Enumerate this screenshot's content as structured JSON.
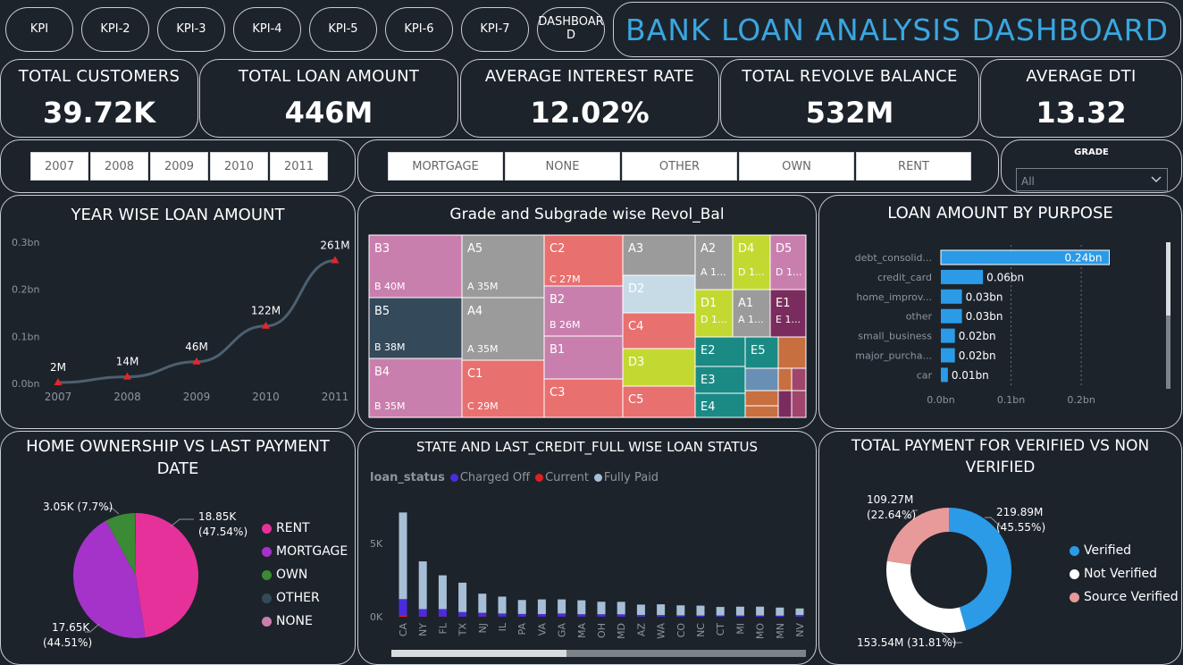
{
  "nav": {
    "buttons": [
      "KPI",
      "KPI-2",
      "KPI-3",
      "KPI-4",
      "KPI-5",
      "KPI-6",
      "KPI-7",
      "DASHBOARD"
    ],
    "dashboard_line1": "DASHBOAR",
    "dashboard_line2": "D"
  },
  "title": "BANK LOAN ANALYSIS DASHBOARD",
  "kpis": [
    {
      "label": "TOTAL CUSTOMERS",
      "value": "39.72K"
    },
    {
      "label": "TOTAL LOAN AMOUNT",
      "value": "446M"
    },
    {
      "label": "AVERAGE INTEREST RATE",
      "value": "12.02%"
    },
    {
      "label": "TOTAL REVOLVE BALANCE",
      "value": "532M"
    },
    {
      "label": "AVERAGE DTI",
      "value": "13.32"
    }
  ],
  "year_slicer": [
    "2007",
    "2008",
    "2009",
    "2010",
    "2011"
  ],
  "ownership_slicer": [
    "MORTGAGE",
    "NONE",
    "OTHER",
    "OWN",
    "RENT"
  ],
  "grade_filter": {
    "label": "GRADE",
    "value": "All"
  },
  "year_chart": {
    "title": "YEAR WISE LOAN AMOUNT",
    "chart_data": {
      "type": "line",
      "x": [
        "2007",
        "2008",
        "2009",
        "2010",
        "2011"
      ],
      "values": [
        2,
        14,
        46,
        122,
        261
      ],
      "labels": [
        "2M",
        "14M",
        "46M",
        "122M",
        "261M"
      ],
      "yticks": [
        "0.3bn",
        "0.2bn",
        "0.1bn",
        "0.0bn"
      ],
      "ylim": [
        0,
        300
      ]
    }
  },
  "treemap": {
    "title": "Grade and Subgrade wise Revol_Bal",
    "cells": [
      {
        "name": "B3",
        "value": "B 40M",
        "color": "#c97fae"
      },
      {
        "name": "B5",
        "value": "B 38M",
        "color": "#34495a"
      },
      {
        "name": "B4",
        "value": "B 35M",
        "color": "#c97fae"
      },
      {
        "name": "A5",
        "value": "A 35M",
        "color": "#9b9b9b"
      },
      {
        "name": "A4",
        "value": "A 35M",
        "color": "#9b9b9b"
      },
      {
        "name": "C1",
        "value": "C 29M",
        "color": "#e8706e"
      },
      {
        "name": "C2",
        "value": "C 27M",
        "color": "#e8706e"
      },
      {
        "name": "B2",
        "value": "B 26M",
        "color": "#c97fae"
      },
      {
        "name": "B1",
        "value": "",
        "color": "#c97fae"
      },
      {
        "name": "C3",
        "value": "",
        "color": "#e8706e"
      },
      {
        "name": "A3",
        "value": "",
        "color": "#9b9b9b"
      },
      {
        "name": "D2",
        "value": "",
        "color": "#c7dbe7"
      },
      {
        "name": "C4",
        "value": "",
        "color": "#e8706e"
      },
      {
        "name": "D3",
        "value": "",
        "color": "#c3d932"
      },
      {
        "name": "C5",
        "value": "",
        "color": "#e8706e"
      },
      {
        "name": "A2",
        "value": "A 1...",
        "color": "#9b9b9b"
      },
      {
        "name": "D4",
        "value": "D 1...",
        "color": "#c3d932"
      },
      {
        "name": "D5",
        "value": "D 1...",
        "color": "#c97fae"
      },
      {
        "name": "D1",
        "value": "D 1...",
        "color": "#c3d932"
      },
      {
        "name": "A1",
        "value": "A 1...",
        "color": "#9b9b9b"
      },
      {
        "name": "E1",
        "value": "E 1...",
        "color": "#7b2c5e"
      },
      {
        "name": "E2",
        "value": "",
        "color": "#1b8a84"
      },
      {
        "name": "E5",
        "value": "",
        "color": "#1b8a84"
      },
      {
        "name": "E3",
        "value": "",
        "color": "#1b8a84"
      },
      {
        "name": "E4",
        "value": "",
        "color": "#1b8a84"
      }
    ]
  },
  "purpose_chart": {
    "title": "LOAN AMOUNT BY PURPOSE",
    "chart_data": {
      "type": "bar",
      "categories": [
        "debt_consolid...",
        "credit_card",
        "home_improv...",
        "other",
        "small_business",
        "major_purcha...",
        "car"
      ],
      "values": [
        0.24,
        0.06,
        0.03,
        0.03,
        0.02,
        0.02,
        0.01
      ],
      "labels": [
        "0.24bn",
        "0.06bn",
        "0.03bn",
        "0.03bn",
        "0.02bn",
        "0.02bn",
        "0.01bn"
      ],
      "xticks": [
        "0.0bn",
        "0.1bn",
        "0.2bn"
      ],
      "xlim": [
        0,
        0.275
      ]
    }
  },
  "home_chart": {
    "title_line1": "HOME OWNERSHIP VS LAST PAYMENT",
    "title_line2": "DATE",
    "chart_data": {
      "type": "pie",
      "labels": [
        "RENT",
        "MORTGAGE",
        "OWN",
        "OTHER",
        "NONE"
      ],
      "values": [
        47.54,
        44.51,
        7.7,
        0.2,
        0.05
      ],
      "colors": [
        "#e6319b",
        "#a533c9",
        "#3b8a36",
        "#34495a",
        "#c97fae"
      ],
      "slice_labels": [
        {
          "line1": "18.85K",
          "line2": "(47.54%)"
        },
        {
          "line1": "17.65K",
          "line2": "(44.51%)"
        },
        {
          "line1": "3.05K (7.7%)",
          "line2": ""
        }
      ]
    }
  },
  "state_chart": {
    "title": "STATE AND LAST_CREDIT_FULL WISE LOAN STATUS",
    "legend_title": "loan_status",
    "legend": [
      {
        "name": "Charged Off",
        "color": "#4b2be0"
      },
      {
        "name": "Current",
        "color": "#e02020"
      },
      {
        "name": "Fully Paid",
        "color": "#a6bfd6"
      }
    ],
    "chart_data": {
      "type": "bar",
      "categories": [
        "CA",
        "NY",
        "FL",
        "TX",
        "NJ",
        "IL",
        "PA",
        "VA",
        "GA",
        "MA",
        "OH",
        "MD",
        "AZ",
        "WA",
        "CO",
        "NC",
        "CT",
        "MI",
        "MO",
        "MN",
        "NV"
      ],
      "series": [
        {
          "name": "Charged Off",
          "values": [
            1100,
            500,
            500,
            310,
            250,
            210,
            180,
            170,
            210,
            160,
            160,
            160,
            120,
            110,
            90,
            80,
            80,
            80,
            80,
            70,
            110
          ]
        },
        {
          "name": "Current",
          "values": [
            100,
            20,
            20,
            10,
            20,
            10,
            10,
            10,
            10,
            10,
            10,
            5,
            5,
            5,
            5,
            5,
            5,
            5,
            5,
            5,
            5
          ]
        },
        {
          "name": "Fully Paid",
          "values": [
            5900,
            3250,
            2300,
            2000,
            1300,
            1150,
            950,
            1000,
            960,
            950,
            850,
            850,
            700,
            730,
            680,
            670,
            580,
            600,
            600,
            550,
            450
          ]
        }
      ],
      "yticks": [
        "5K",
        "0K"
      ],
      "ylim": [
        0,
        7000
      ]
    }
  },
  "payment_chart": {
    "title_line1": "TOTAL PAYMENT FOR VERIFIED VS NON",
    "title_line2": "VERIFIED",
    "chart_data": {
      "type": "pie",
      "labels": [
        "Verified",
        "Not Verified",
        "Source Verified"
      ],
      "values": [
        45.55,
        31.81,
        22.64
      ],
      "colors": [
        "#2b9be8",
        "#ffffff",
        "#e89a9a"
      ],
      "slice_labels": [
        {
          "line1": "219.89M",
          "line2": "(45.55%)"
        },
        {
          "line1": "153.54M (31.81%)",
          "line2": ""
        },
        {
          "line1": "109.27M",
          "line2": "(22.64%)"
        }
      ]
    }
  }
}
